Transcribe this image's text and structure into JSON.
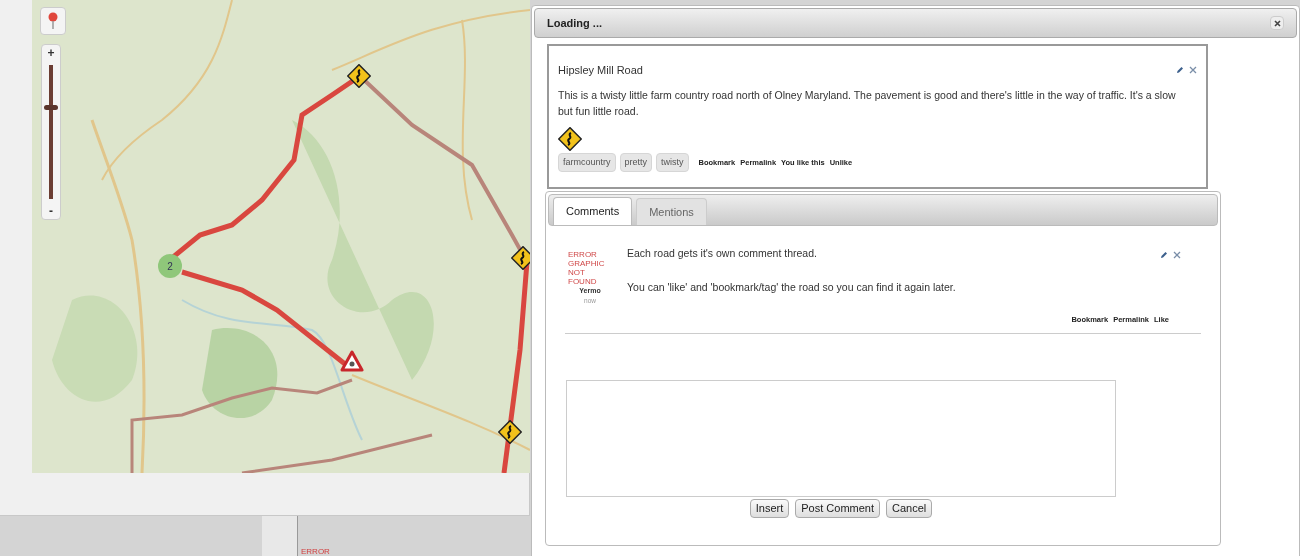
{
  "map": {
    "cluster": {
      "label": "2"
    },
    "zoom": {
      "plus": "+",
      "minus": "-",
      "level": 0.68
    }
  },
  "dialog": {
    "title": "Loading ...",
    "road": {
      "title": "Hipsley Mill Road",
      "description": "This is a twisty little farm country road north of Olney Maryland. The pavement is good and there's little in the way of traffic. It's a slow but fun little road.",
      "tags": [
        "farmcountry",
        "pretty",
        "twisty"
      ],
      "actions": [
        "Bookmark",
        "Permalink",
        "You like this",
        "Unlike"
      ]
    },
    "tabs": [
      {
        "label": "Comments",
        "selected": true
      },
      {
        "label": "Mentions",
        "selected": false
      }
    ],
    "comments": [
      {
        "avatar_error": "ERROR GRAPHIC NOT FOUND",
        "author": "Yermo",
        "time": "now",
        "paragraphs": [
          "Each road gets it's own comment thread.",
          "You can 'like' and 'bookmark/tag' the road so you can find it again later."
        ],
        "actions": [
          "Bookmark",
          "Permalink",
          "Like"
        ]
      }
    ],
    "composer": {
      "buttons": [
        "Insert",
        "Post Comment",
        "Cancel"
      ]
    }
  },
  "bottom_fragment": "ERROR"
}
